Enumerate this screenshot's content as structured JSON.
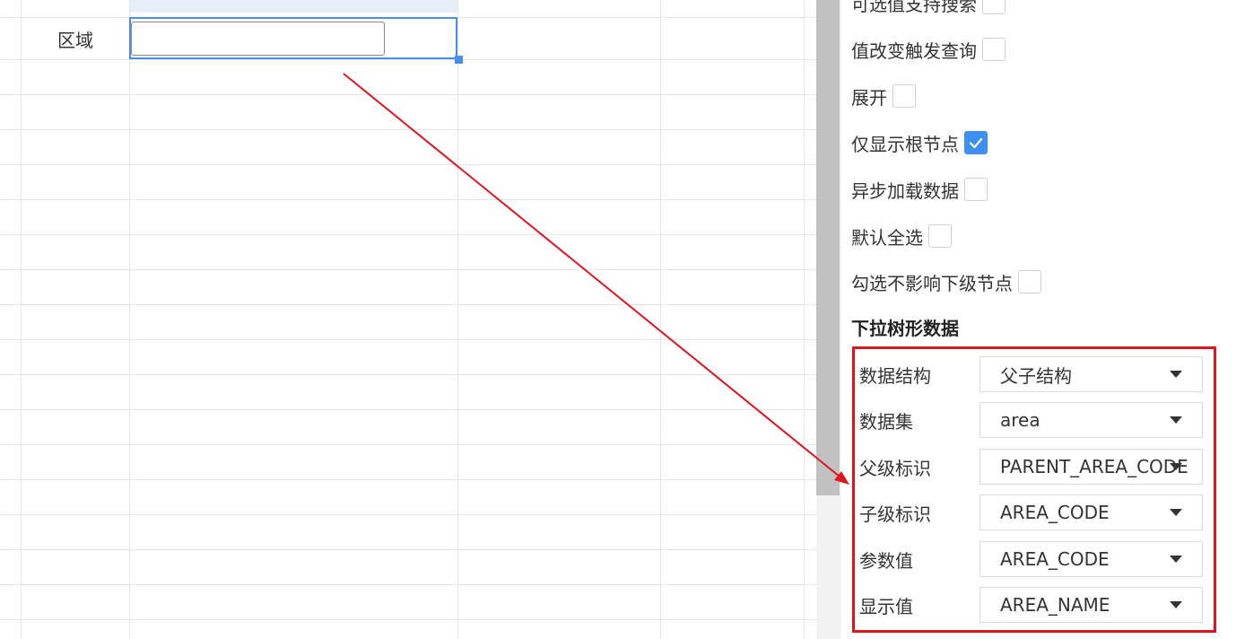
{
  "sheet": {
    "cell_label": "区域"
  },
  "panel": {
    "partial_top_label": "可选值支持搜索",
    "checkboxes": [
      {
        "label": "值改变触发查询",
        "checked": false
      },
      {
        "label": "展开",
        "checked": false
      },
      {
        "label": "仅显示根节点",
        "checked": true
      },
      {
        "label": "异步加载数据",
        "checked": false
      },
      {
        "label": "默认全选",
        "checked": false
      },
      {
        "label": "勾选不影响下级节点",
        "checked": false
      }
    ],
    "section_title": "下拉树形数据",
    "fields": [
      {
        "label": "数据结构",
        "value": "父子结构"
      },
      {
        "label": "数据集",
        "value": "area"
      },
      {
        "label": "父级标识",
        "value": "PARENT_AREA_CODE"
      },
      {
        "label": "子级标识",
        "value": "AREA_CODE"
      },
      {
        "label": "参数值",
        "value": "AREA_CODE"
      },
      {
        "label": "显示值",
        "value": "AREA_NAME"
      }
    ]
  },
  "colors": {
    "accent": "#4a8cf0",
    "checkbox_checked": "#3d8ff0",
    "annotation_red": "#e0141e"
  }
}
